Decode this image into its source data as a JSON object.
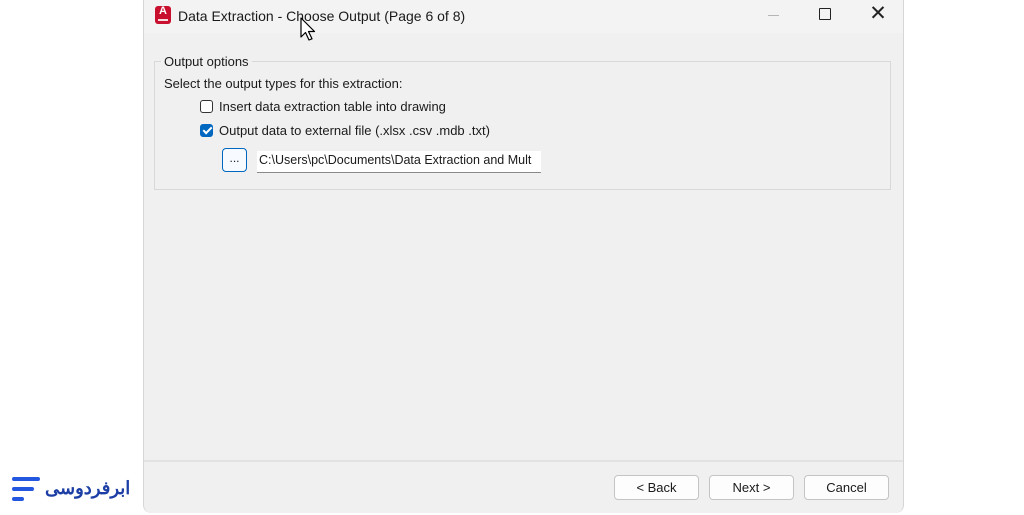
{
  "window": {
    "title": "Data Extraction - Choose Output (Page 6 of 8)",
    "app_icon_letter": "A",
    "close_glyph": "✕"
  },
  "output_options": {
    "legend": "Output options",
    "description": "Select the output types for this extraction:",
    "options": [
      {
        "label": "Insert data extraction table into drawing",
        "checked": false
      },
      {
        "label": "Output data to external file (.xlsx .csv .mdb .txt)",
        "checked": true
      }
    ],
    "browse_label": "...",
    "file_path": "C:\\Users\\pc\\Documents\\Data Extraction and Mult"
  },
  "footer": {
    "back_label": "< Back",
    "next_label": "Next >",
    "cancel_label": "Cancel"
  },
  "watermark": {
    "text": "ابرفردوسی"
  },
  "colors": {
    "accent": "#0067c0",
    "app_icon": "#c8102e",
    "watermark": "#1d3fa5"
  }
}
